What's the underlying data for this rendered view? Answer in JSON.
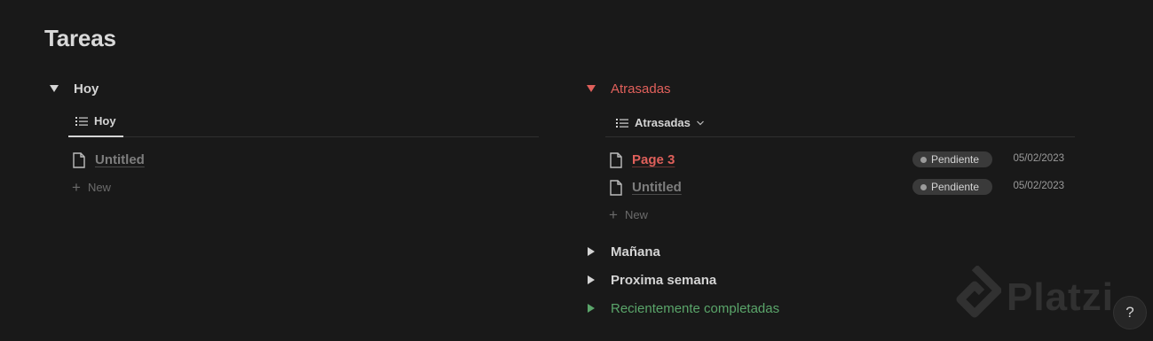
{
  "page": {
    "title": "Tareas"
  },
  "colors": {
    "red": "#e0605b",
    "green": "#5aa56a",
    "white": "#d4d4d4",
    "muted": "#7d7d7d"
  },
  "left": {
    "toggle": {
      "label": "Hoy",
      "state": "open"
    },
    "view": {
      "label": "Hoy",
      "icon": "list-icon"
    },
    "rows": [
      {
        "title": "Untitled",
        "icon": "page-icon"
      }
    ],
    "new_label": "New"
  },
  "right": {
    "overdue": {
      "label": "Atrasadas",
      "state": "open",
      "view": {
        "label": "Atrasadas",
        "icon": "list-icon"
      },
      "rows": [
        {
          "title": "Page 3",
          "status": "Pendiente",
          "date": "05/02/2023"
        },
        {
          "title": "Untitled",
          "status": "Pendiente",
          "date": "05/02/2023"
        }
      ],
      "new_label": "New"
    },
    "collapsed_sections": [
      {
        "label": "Mañana"
      },
      {
        "label": "Proxima semana"
      },
      {
        "label": "Recientemente completadas"
      }
    ]
  },
  "watermark": {
    "text": "Platzi"
  },
  "help": {
    "label": "?"
  }
}
